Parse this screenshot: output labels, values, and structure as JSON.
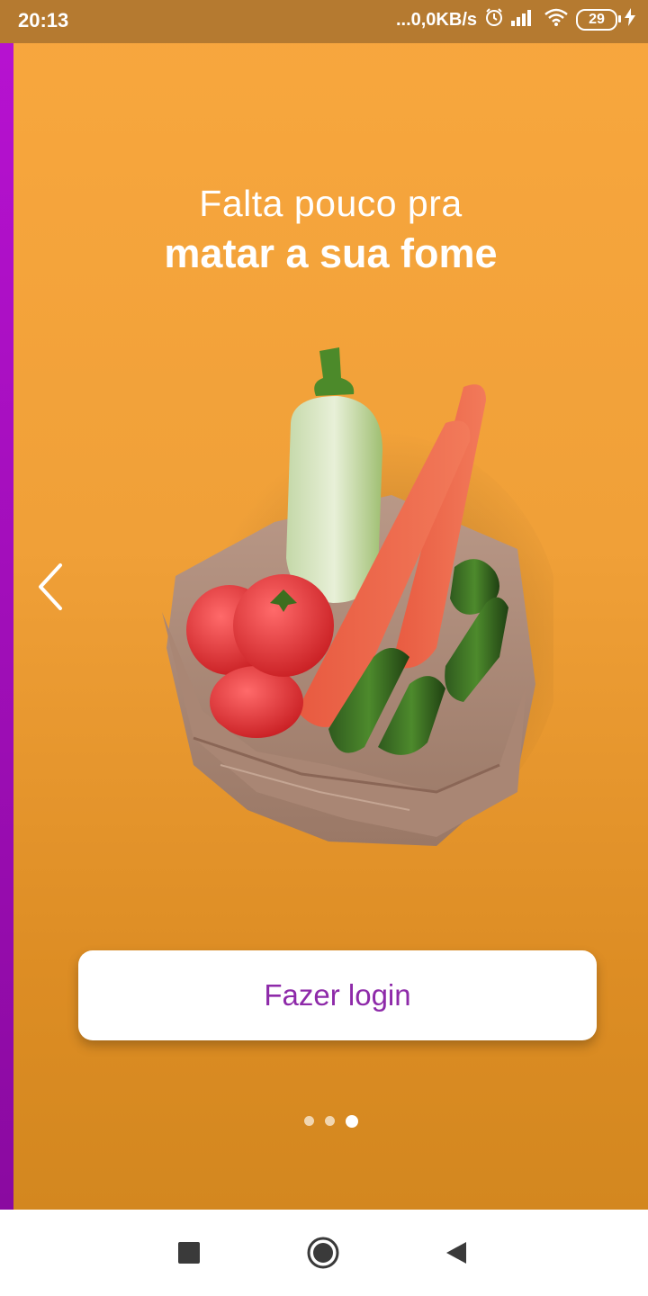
{
  "status_bar": {
    "time": "20:13",
    "network_speed": "...0,0KB/s",
    "battery_level": "29",
    "icons": [
      "alarm-icon",
      "signal-icon",
      "wifi-icon",
      "battery-icon",
      "charging-icon"
    ]
  },
  "onboarding": {
    "headline_line1": "Falta pouco pra",
    "headline_line2": "matar a sua fome",
    "illustration": "vegetables-in-paper-bag",
    "login_button": "Fazer login",
    "pagination": {
      "total": 3,
      "active": 3
    }
  },
  "nav_bar": {
    "buttons": [
      "recent-apps-button",
      "home-button",
      "back-button"
    ]
  },
  "colors": {
    "background_orange": "#f8a73e",
    "accent_purple": "#8e2aa9",
    "left_strip": "#b812d2"
  }
}
